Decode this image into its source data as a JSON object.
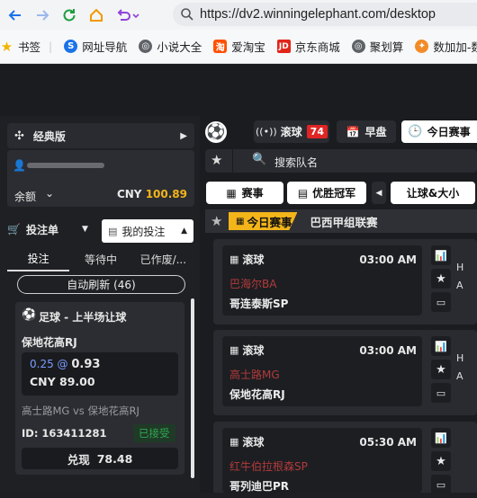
{
  "browser": {
    "url": "https://dv2.winningelephant.com/desktop"
  },
  "bookmarks": [
    {
      "label": "书签",
      "color": "#f4b400"
    },
    {
      "label": "网址导航",
      "color": "#1a73e8"
    },
    {
      "label": "小说大全",
      "color": "#5f6368"
    },
    {
      "label": "爱淘宝",
      "color": "#ff5000"
    },
    {
      "label": "京东商城",
      "color": "#e1251b"
    },
    {
      "label": "聚划算",
      "color": "#5f6368"
    },
    {
      "label": "数加加-数据",
      "color": "#f28c28"
    }
  ],
  "left": {
    "classic_label": "经典版",
    "balance_label": "余额",
    "currency": "CNY",
    "balance": "100.89",
    "betslip_label": "投注单",
    "my_bets_label": "我的投注",
    "tabs": [
      "投注",
      "等待中",
      "已作废/..."
    ],
    "auto_refresh": "自动刷新 (46)",
    "bet": {
      "market": "足球 - 上半场让球",
      "selection": "保地花高RJ",
      "handicap": "0.25 @",
      "odds": "0.93",
      "stake": "CNY 89.00",
      "home": "高士路MG",
      "vs": "vs",
      "away": "保地花高RJ",
      "id": "ID: 163411281",
      "status": "已接受",
      "cashout_label": "兑现",
      "cashout_value": "78.48"
    }
  },
  "right": {
    "live_label": "滚球",
    "live_count": "74",
    "early_label": "早盘",
    "today_label": "今日赛事",
    "search_placeholder": "搜索队名",
    "sub_tabs": {
      "matches": "赛事",
      "outright": "优胜冠军",
      "handicap": "让球&大小"
    },
    "today_tag": "今日赛事",
    "league": "巴西甲组联赛",
    "matches": [
      {
        "status": "滚球",
        "time": "03:00 AM",
        "team1": "巴海尔BA",
        "team2": "哥连泰斯SP"
      },
      {
        "status": "滚球",
        "time": "03:00 AM",
        "team1": "高士路MG",
        "team2": "保地花高RJ"
      },
      {
        "status": "滚球",
        "time": "05:30 AM",
        "team1": "红牛伯拉根森SP",
        "team2": "哥列迪巴PR"
      }
    ],
    "col_labels": [
      "H",
      "A"
    ]
  },
  "colors": {
    "accent": "#f3b51a",
    "live_badge": "#e02424",
    "accepted_green": "#2fa84f",
    "team_red": "#b23b3b",
    "odds_blue": "#7a9cff"
  }
}
